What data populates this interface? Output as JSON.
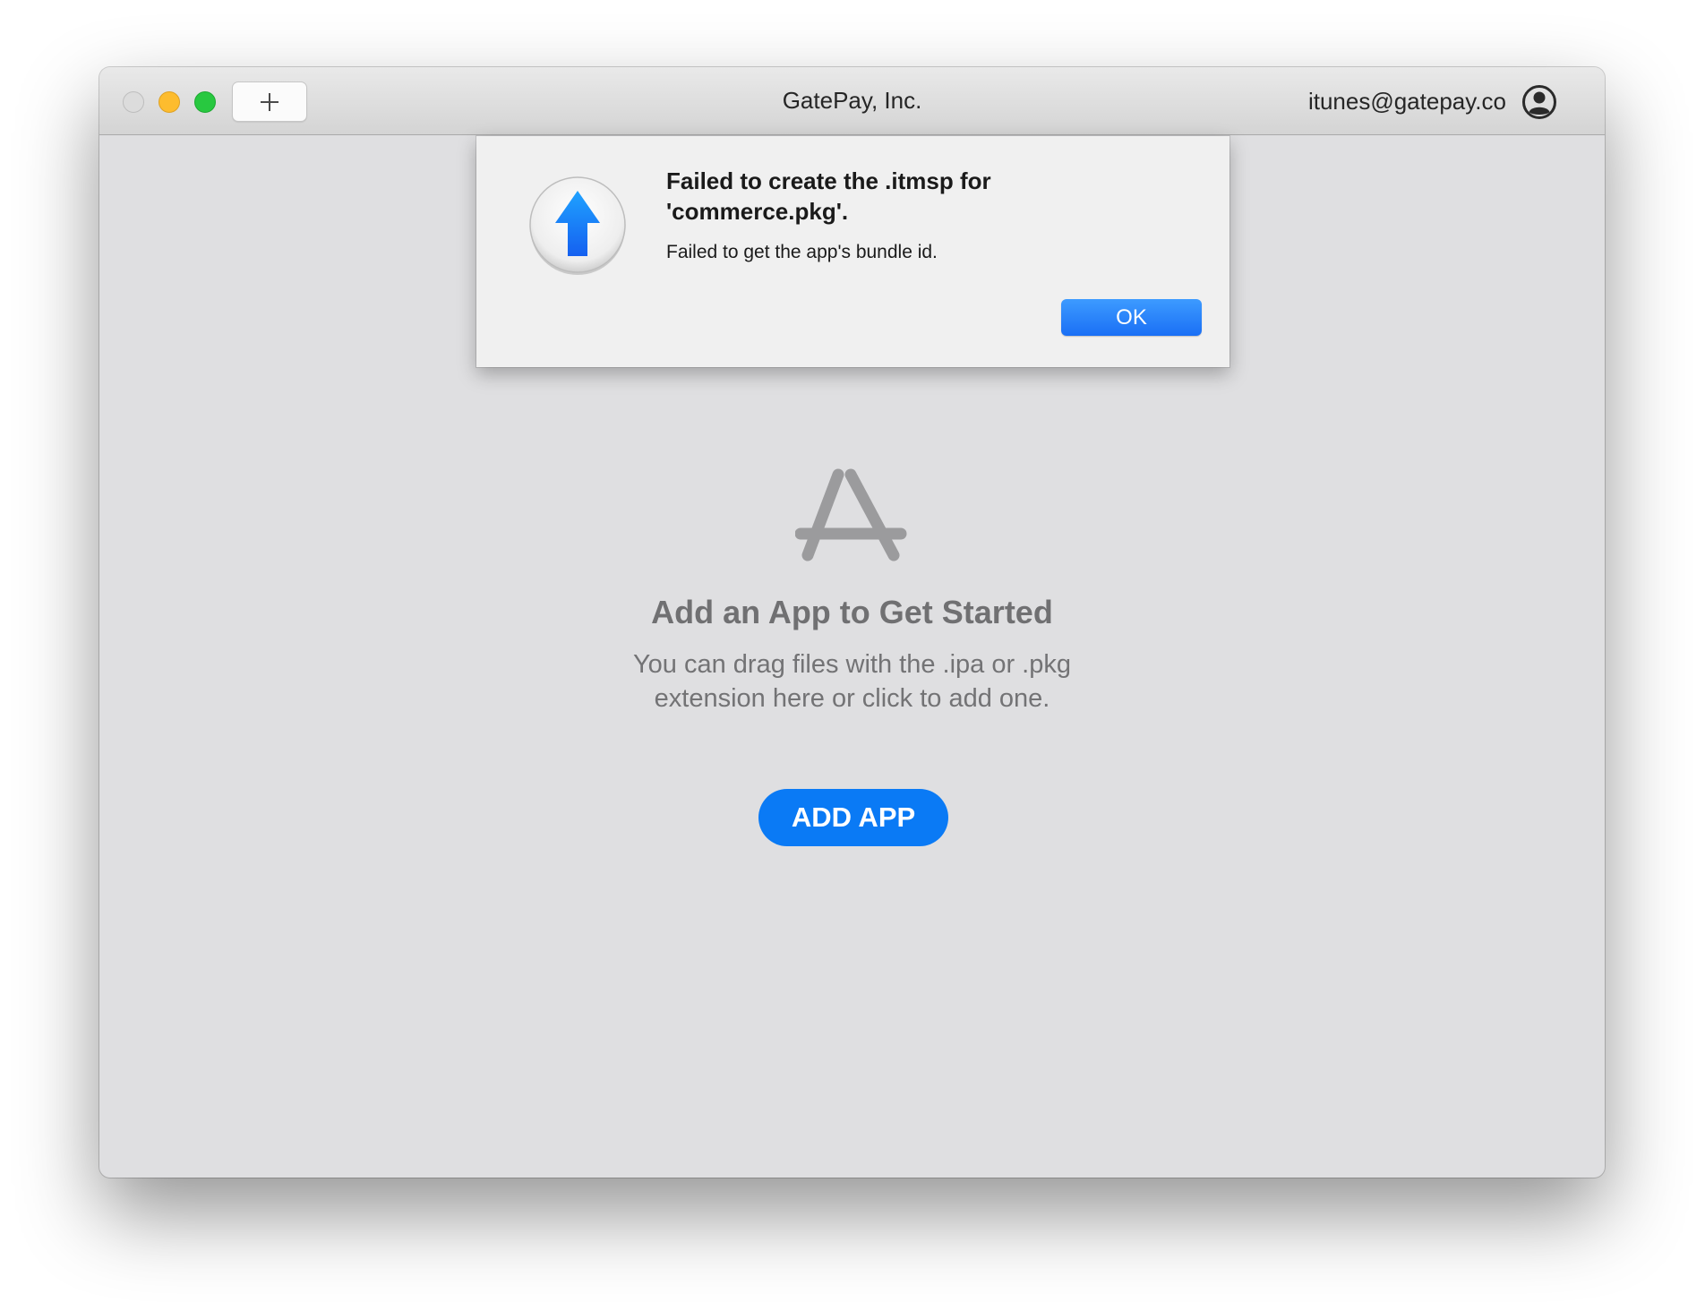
{
  "window": {
    "title": "GatePay, Inc.",
    "account_email": "itunes@gatepay.co"
  },
  "toolbar": {
    "add_icon": "plus-icon"
  },
  "alert": {
    "icon": "upload-arrow-icon",
    "title": "Failed to create the .itmsp for 'commerce.pkg'.",
    "message": "Failed to get the app's bundle id.",
    "ok_label": "OK"
  },
  "empty_state": {
    "icon": "app-store-icon",
    "title": "Add an App to Get Started",
    "subtitle_lines": [
      "You can drag files with the .ipa or .pkg",
      "extension here or click to add one."
    ],
    "button_label": "ADD APP"
  },
  "colors": {
    "accent": "#0a7af5",
    "window_bg": "#dfdfe1",
    "alert_bg": "#f0f0f0",
    "muted_text": "#707072"
  }
}
